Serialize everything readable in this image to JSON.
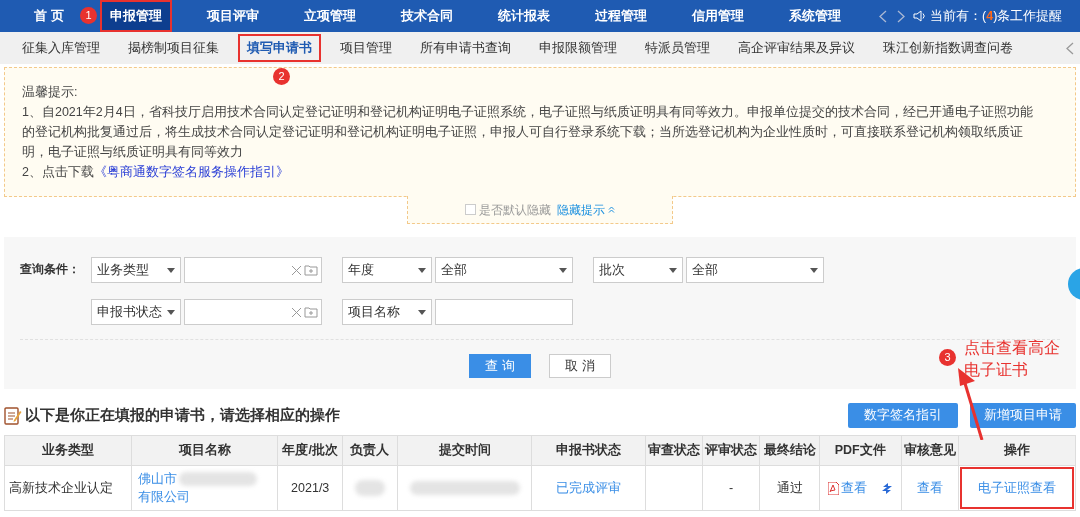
{
  "nav": {
    "items": [
      {
        "label": "首 页",
        "selected": false,
        "annotated": false
      },
      {
        "label": "申报管理",
        "selected": true,
        "annotated": true,
        "badge": "1"
      },
      {
        "label": "项目评审",
        "selected": false,
        "annotated": false
      },
      {
        "label": "立项管理",
        "selected": false,
        "annotated": false
      },
      {
        "label": "技术合同",
        "selected": false,
        "annotated": false
      },
      {
        "label": "统计报表",
        "selected": false,
        "annotated": false
      },
      {
        "label": "过程管理",
        "selected": false,
        "annotated": false
      },
      {
        "label": "信用管理",
        "selected": false,
        "annotated": false
      },
      {
        "label": "系统管理",
        "selected": false,
        "annotated": false
      }
    ],
    "reminder_prefix": "当前有：(",
    "reminder_count": "4",
    "reminder_suffix": ")条工作提醒"
  },
  "subnav": [
    {
      "label": "征集入库管理",
      "selected": false,
      "annotated": false
    },
    {
      "label": "揭榜制项目征集",
      "selected": false,
      "annotated": false
    },
    {
      "label": "填写申请书",
      "selected": true,
      "annotated": true,
      "badge": "2"
    },
    {
      "label": "项目管理",
      "selected": false,
      "annotated": false
    },
    {
      "label": "所有申请书查询",
      "selected": false,
      "annotated": false
    },
    {
      "label": "申报限额管理",
      "selected": false,
      "annotated": false
    },
    {
      "label": "特派员管理",
      "selected": false,
      "annotated": false
    },
    {
      "label": "高企评审结果及异议",
      "selected": false,
      "annotated": false
    },
    {
      "label": "珠江创新指数调查问卷",
      "selected": false,
      "annotated": false
    }
  ],
  "notice": {
    "title": "温馨提示:",
    "line1": "1、自2021年2月4日，省科技厅启用技术合同认定登记证明和登记机构证明电子证照系统，电子证照与纸质证明具有同等效力。申报单位提交的技术合同，经已开通电子证照功能的登记机构批复通过后，将生成技术合同认定登记证明和登记机构证明电子证照，申报人可自行登录系统下载；当所选登记机构为企业性质时，可直接联系登记机构领取纸质证明，电子证照与纸质证明具有同等效力",
    "line2_prefix": "2、点击下载",
    "line2_link": "《粤商通数字签名服务操作指引》",
    "hide_default_label": "是否默认隐藏",
    "hide_default_checked": false,
    "hide_link": "隐藏提示"
  },
  "query": {
    "label": "查询条件：",
    "rows": [
      [
        {
          "kind": "select",
          "value": "业务类型"
        },
        {
          "kind": "picker"
        },
        {
          "kind": "select",
          "value": "年度"
        },
        {
          "kind": "select-wide",
          "value": "全部"
        },
        {
          "kind": "select",
          "value": "批次"
        },
        {
          "kind": "select-wide",
          "value": "全部"
        }
      ],
      [
        {
          "kind": "select",
          "value": "申报书状态"
        },
        {
          "kind": "picker"
        },
        {
          "kind": "select",
          "value": "项目名称"
        },
        {
          "kind": "input"
        }
      ]
    ],
    "buttons": [
      {
        "label": "查 询",
        "primary": true
      },
      {
        "label": "取 消",
        "primary": false
      }
    ]
  },
  "list": {
    "heading": "以下是你正在填报的申请书，请选择相应的操作",
    "buttons": [
      "数字签名指引",
      "新增项目申请"
    ],
    "columns": [
      "业务类型",
      "项目名称",
      "年度/批次",
      "负责人",
      "提交时间",
      "申报书状态",
      "审查状态",
      "评审状态",
      "最终结论",
      "PDF文件",
      "审核意见",
      "操作"
    ],
    "rows": [
      {
        "type": "高新技术企业认定",
        "name_start": "佛山市",
        "name_end": "有限公司",
        "year_batch": "2021/3",
        "status": "已完成评审",
        "review": "-",
        "conclusion": "通过",
        "pdf": "查看",
        "opinion": "查看",
        "action": "电子证照查看",
        "action_annotated": true,
        "action_badge": "3"
      }
    ]
  },
  "annotation": {
    "text_line1": "点击查看高企",
    "text_line2": "电子证书"
  }
}
